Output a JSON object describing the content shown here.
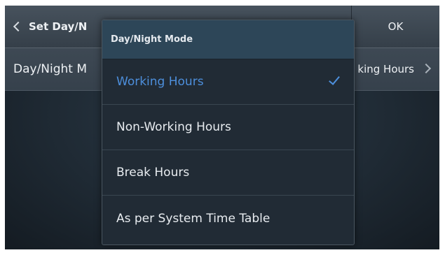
{
  "header": {
    "title": "Set Day/N",
    "ok_label": "OK"
  },
  "setting": {
    "label": "Day/Night M",
    "value": "king Hours"
  },
  "dropdown": {
    "title": "Day/Night Mode",
    "options": [
      {
        "label": "Working Hours",
        "selected": true
      },
      {
        "label": "Non-Working Hours",
        "selected": false
      },
      {
        "label": "Break Hours",
        "selected": false
      },
      {
        "label": "As per System Time Table",
        "selected": false
      }
    ]
  },
  "colors": {
    "accent": "#4d8fdc",
    "header_bg": "#2d4658"
  },
  "icons": [
    "chevron-left-icon",
    "chevron-right-icon",
    "check-icon"
  ]
}
